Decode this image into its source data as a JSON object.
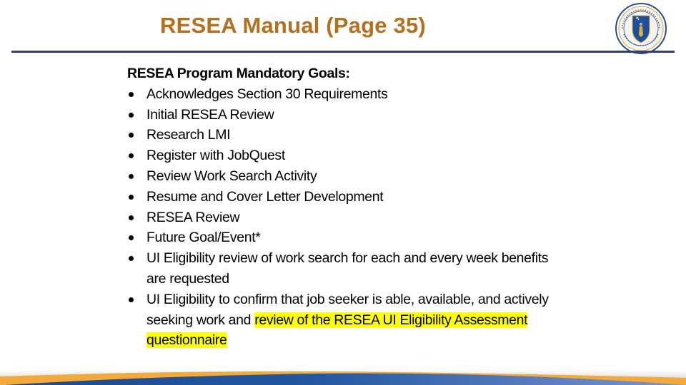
{
  "slide": {
    "title": "RESEA Manual (Page 35)",
    "logo": "massachusetts-state-seal"
  },
  "colors": {
    "title": "#b5701d",
    "divider": "#343a7c",
    "highlight": "#ffff00",
    "footer_blue": "#1f4e94",
    "footer_orange": "#f4a93a"
  },
  "content": {
    "heading": "RESEA Program Mandatory Goals:",
    "items": [
      {
        "lines": [
          "Acknowledges Section 30 Requirements"
        ]
      },
      {
        "lines": [
          "Initial RESEA Review"
        ]
      },
      {
        "lines": [
          "Research LMI"
        ]
      },
      {
        "lines": [
          "Register with JobQuest"
        ]
      },
      {
        "lines": [
          "Review Work Search Activity"
        ]
      },
      {
        "lines": [
          "Resume and Cover Letter Development"
        ]
      },
      {
        "lines": [
          "RESEA Review"
        ]
      },
      {
        "lines": [
          "Future Goal/Event*"
        ]
      },
      {
        "lines": [
          "UI Eligibility review of work search for each and every week benefits",
          "are requested"
        ]
      },
      {
        "line1": "UI Eligibility to confirm that job seeker is able, available, and actively",
        "line2_plain": "seeking work and ",
        "line2_highlight": "review of the RESEA UI Eligibility Assessment ",
        "line3_highlight": "questionnaire"
      }
    ]
  }
}
